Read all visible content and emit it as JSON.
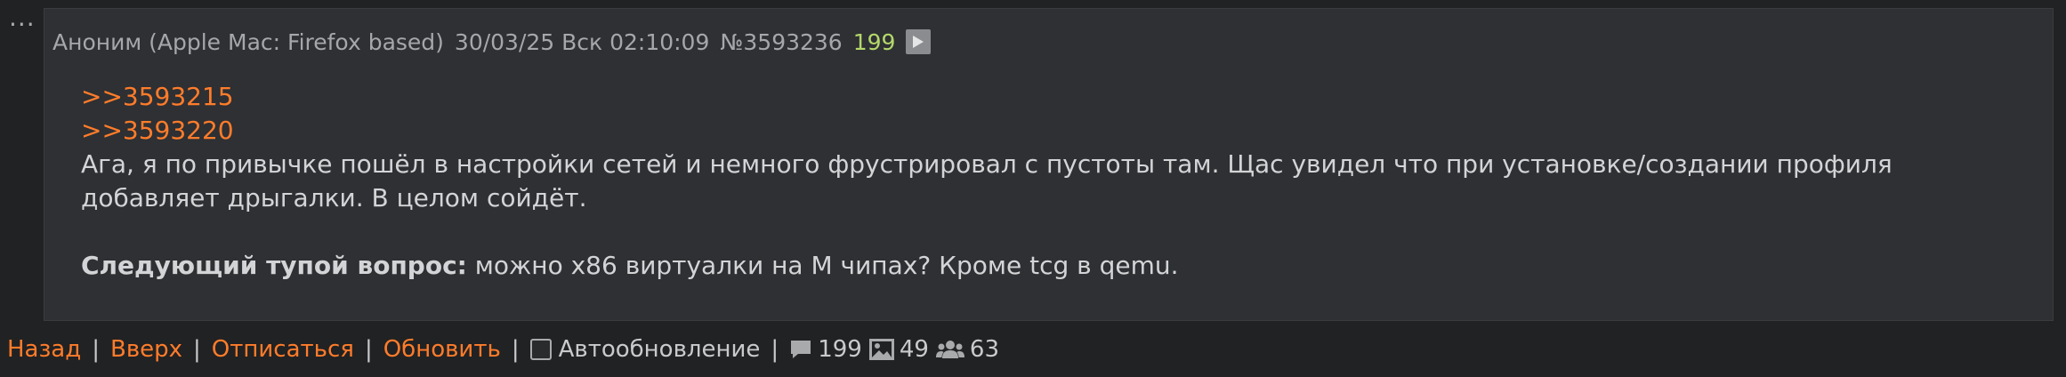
{
  "post": {
    "author": "Аноним (Apple Mac: Firefox based)",
    "datetime": "30/03/25 Вск 02:10:09",
    "number": "№3593236",
    "reply_count": "199",
    "reply_links": [
      ">>3593215",
      ">>3593220"
    ],
    "paragraph1": "Ага, я по привычке пошёл в настройки сетей и немного фрустрировал с пустоты там. Щас увидел что при установке/создании профиля добавляет дрыгалки. В целом сойдёт.",
    "question_bold": "Следующий тупой вопрос:",
    "question_text": " можно x86 виртуалки на M чипах? Кроме tcg в qemu."
  },
  "menu": {
    "dots": "···"
  },
  "footer": {
    "back": "Назад",
    "up": "Вверх",
    "unsubscribe": "Отписаться",
    "refresh": "Обновить",
    "separator": "|",
    "autorefresh_label": "Автообновление",
    "autorefresh_checked": false,
    "posts_count": "199",
    "images_count": "49",
    "posters_count": "63"
  },
  "colors": {
    "background": "#212223",
    "post_background": "#2e3033",
    "link": "#ff7c2b",
    "reply_count": "#b4d76b",
    "text": "#d3d4d6",
    "meta": "#a5a7aa"
  },
  "icons": {
    "play": "play-icon",
    "posts": "comment-icon",
    "images": "image-icon",
    "posters": "users-icon",
    "menu": "more-dots-icon"
  }
}
